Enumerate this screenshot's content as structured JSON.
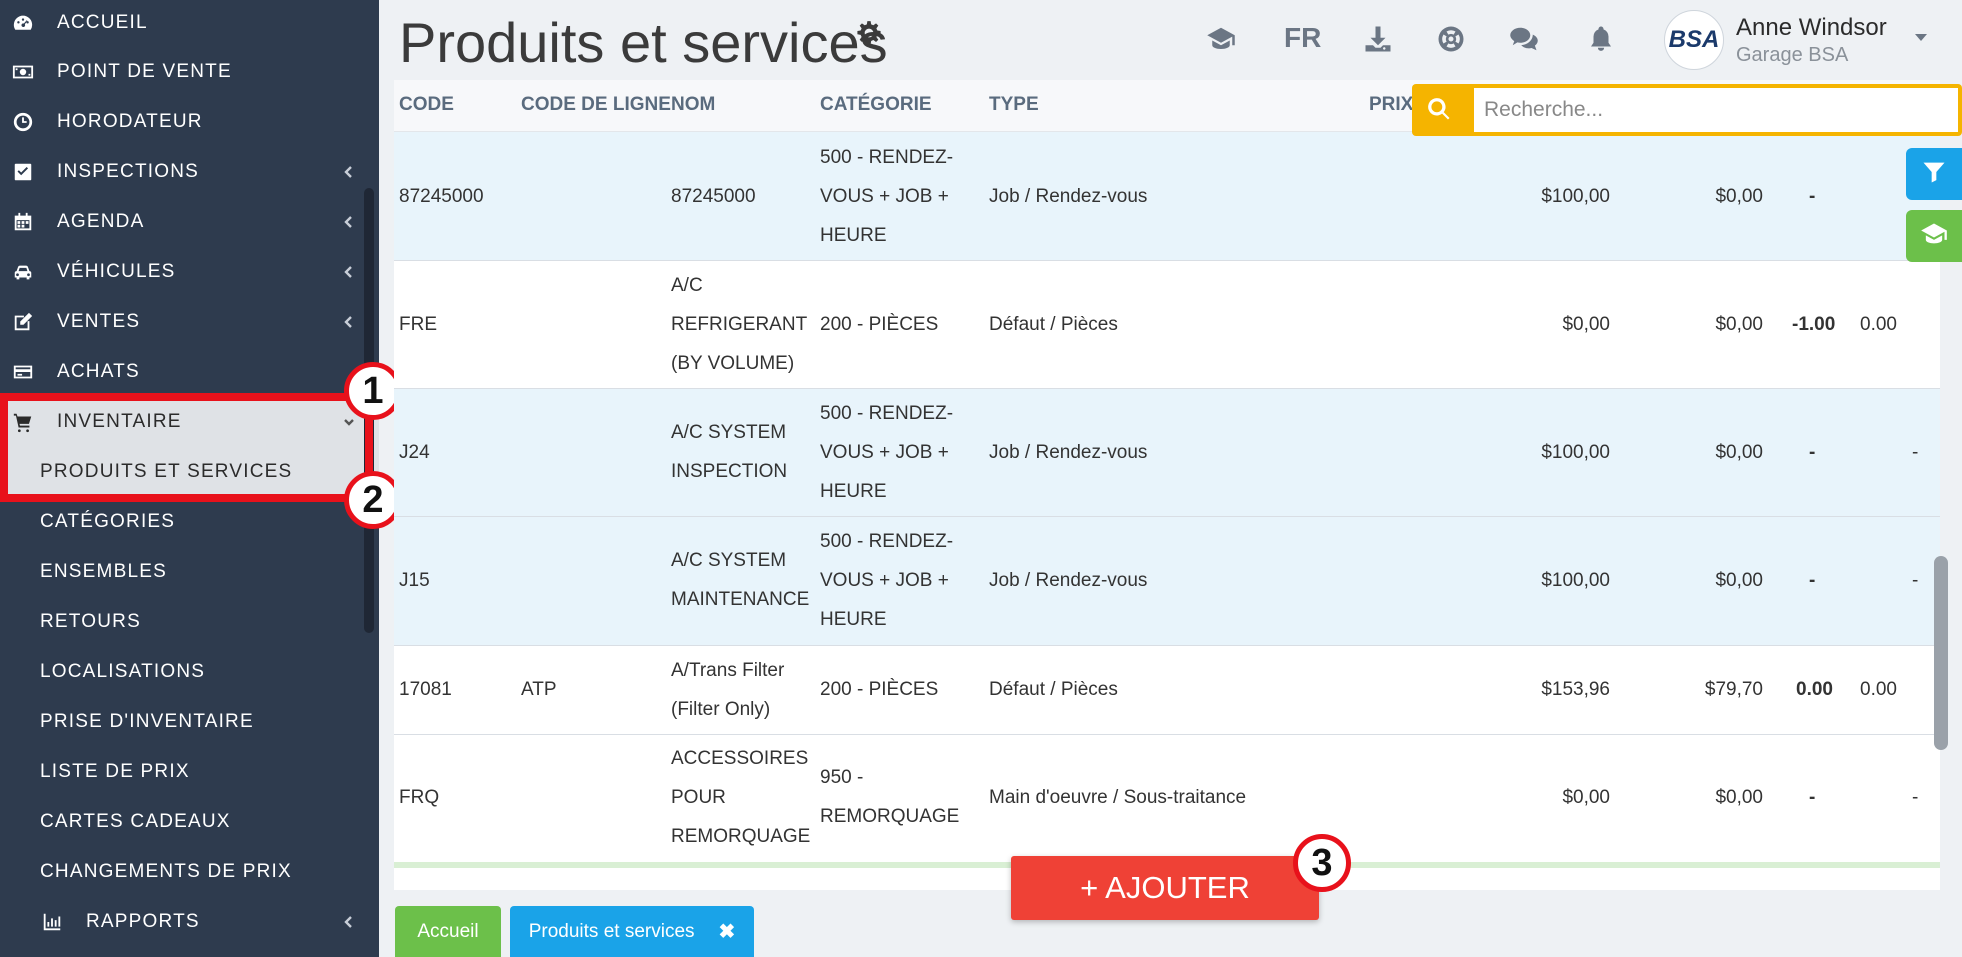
{
  "sidebar": {
    "items": [
      {
        "label": "ACCUEIL"
      },
      {
        "label": "POINT DE VENTE"
      },
      {
        "label": "HORODATEUR"
      },
      {
        "label": "INSPECTIONS"
      },
      {
        "label": "AGENDA"
      },
      {
        "label": "VÉHICULES"
      },
      {
        "label": "VENTES"
      },
      {
        "label": "ACHATS"
      },
      {
        "label": "INVENTAIRE"
      }
    ],
    "subitems": [
      {
        "label": "PRODUITS ET SERVICES"
      },
      {
        "label": "CATÉGORIES"
      },
      {
        "label": "ENSEMBLES"
      },
      {
        "label": "RETOURS"
      },
      {
        "label": "LOCALISATIONS"
      },
      {
        "label": "PRISE D'INVENTAIRE"
      },
      {
        "label": "LISTE DE PRIX"
      },
      {
        "label": "CARTES CADEAUX"
      },
      {
        "label": "CHANGEMENTS DE PRIX"
      }
    ],
    "reports": {
      "label": "RAPPORTS"
    }
  },
  "annotations": [
    "1",
    "2",
    "3"
  ],
  "header": {
    "title": "Produits et services",
    "lang": "FR",
    "user_name": "Anne Windsor",
    "user_garage": "Garage BSA",
    "avatar_text": "BSA"
  },
  "search": {
    "placeholder": "Recherche..."
  },
  "table": {
    "headers": [
      "CODE",
      "CODE DE LIGNE",
      "NOM",
      "CATÉGORIE",
      "TYPE",
      "PRIX"
    ],
    "rows": [
      {
        "code": "87245000",
        "line": "",
        "name": [
          "87245000"
        ],
        "category": [
          "500 - RENDEZ-",
          "VOUS + JOB +",
          "HEURE"
        ],
        "type": "Job / Rendez-vous",
        "price": "$100,00",
        "cost": "$0,00",
        "qty": "-",
        "extra": ""
      },
      {
        "code": "FRE",
        "line": "",
        "name": [
          "A/C",
          "REFRIGERANT",
          "(BY VOLUME)"
        ],
        "category": [
          "200 - PIÈCES"
        ],
        "type": "Défaut / Pièces",
        "price": "$0,00",
        "cost": "$0,00",
        "qty": "-1.00",
        "extra": "0.00"
      },
      {
        "code": "J24",
        "line": "",
        "name": [
          "A/C SYSTEM",
          "INSPECTION"
        ],
        "category": [
          "500 - RENDEZ-",
          "VOUS + JOB +",
          "HEURE"
        ],
        "type": "Job / Rendez-vous",
        "price": "$100,00",
        "cost": "$0,00",
        "qty": "-",
        "extra": "-"
      },
      {
        "code": "J15",
        "line": "",
        "name": [
          "A/C SYSTEM",
          "MAINTENANCE"
        ],
        "category": [
          "500 - RENDEZ-",
          "VOUS + JOB +",
          "HEURE"
        ],
        "type": "Job / Rendez-vous",
        "price": "$100,00",
        "cost": "$0,00",
        "qty": "-",
        "extra": "-"
      },
      {
        "code": "17081",
        "line": "ATP",
        "name": [
          "A/Trans Filter",
          "(Filter Only)"
        ],
        "category": [
          "200 - PIÈCES"
        ],
        "type": "Défaut / Pièces",
        "price": "$153,96",
        "cost": "$79,70",
        "qty": "0.00",
        "extra": "0.00"
      },
      {
        "code": "FRQ",
        "line": "",
        "name": [
          "ACCESSOIRES",
          "POUR",
          "REMORQUAGE"
        ],
        "category": [
          "950 -",
          "REMORQUAGE"
        ],
        "type": "Main d'oeuvre / Sous-traitance",
        "price": "$0,00",
        "cost": "$0,00",
        "qty": "-",
        "extra": "-"
      }
    ]
  },
  "add_button": "+ AJOUTER",
  "tabs": [
    {
      "label": "Accueil"
    },
    {
      "label": "Produits et services"
    }
  ],
  "colors": {
    "sidebar_bg": "#2e3b4e",
    "accent_red": "#ef4136",
    "search_yellow": "#f5b400",
    "filter_blue": "#1aa3e8",
    "help_green": "#6cc04a",
    "annotation_red": "#e8111b"
  }
}
